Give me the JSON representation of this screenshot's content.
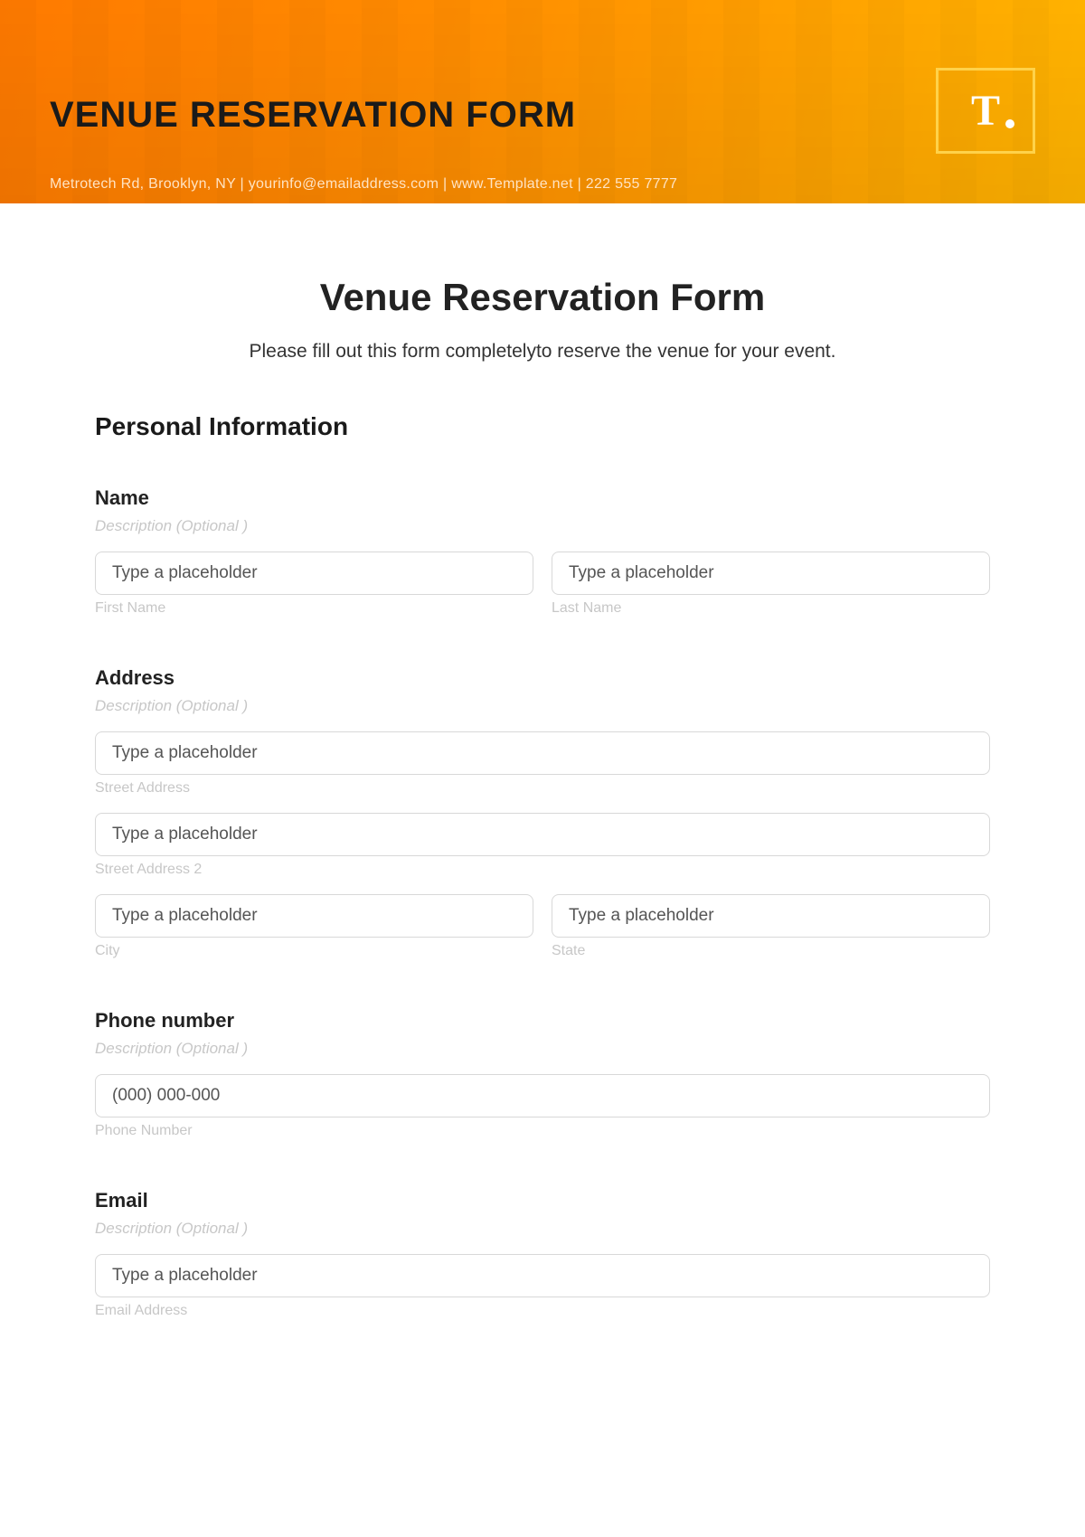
{
  "banner": {
    "title": "VENUE RESERVATION FORM",
    "contact": "Metrotech Rd, Brooklyn, NY  |  yourinfo@emailaddress.com  |  www.Template.net  |  222 555 7777",
    "logo_letter": "T"
  },
  "form": {
    "title": "Venue Reservation Form",
    "intro": "Please fill out this form completelyto reserve the venue for your event.",
    "section_personal": "Personal Information",
    "desc_optional": "Description (Optional )",
    "name": {
      "label": "Name",
      "first_placeholder": "Type a placeholder",
      "first_sub": "First Name",
      "last_placeholder": "Type a placeholder",
      "last_sub": "Last Name"
    },
    "address": {
      "label": "Address",
      "street1_placeholder": "Type a placeholder",
      "street1_sub": "Street Address",
      "street2_placeholder": "Type a placeholder",
      "street2_sub": "Street Address 2",
      "city_placeholder": "Type a placeholder",
      "city_sub": "City",
      "state_placeholder": "Type a placeholder",
      "state_sub": "State"
    },
    "phone": {
      "label": "Phone number",
      "placeholder": "(000) 000-000",
      "sub": "Phone Number"
    },
    "email": {
      "label": "Email",
      "placeholder": "Type a placeholder",
      "sub": "Email Address"
    }
  }
}
